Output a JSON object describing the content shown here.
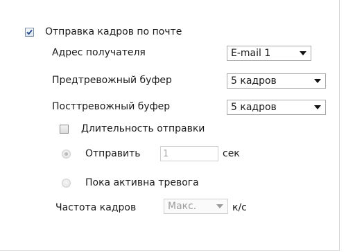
{
  "send_frames": {
    "label": "Отправка кадров по почте",
    "checked": true
  },
  "recipient": {
    "label": "Адрес получателя",
    "value": "E-mail 1"
  },
  "pre_alarm": {
    "label": "Предтревожный буфер",
    "value": "5 кадров"
  },
  "post_alarm": {
    "label": "Посттревожный буфер",
    "value": "5 кадров"
  },
  "duration": {
    "label": "Длительность отправки",
    "checked": false
  },
  "send_for": {
    "label": "Отправить",
    "value": "1",
    "unit": "сек"
  },
  "while_alarm": {
    "label": "Пока активна тревога"
  },
  "frame_rate": {
    "label": "Частота кадров",
    "value": "Макс.",
    "unit": "к/с"
  },
  "colors": {
    "border": "#a8a8a8",
    "disabled_text": "#9b9b9b",
    "checkmark": "#2b4f8f"
  }
}
